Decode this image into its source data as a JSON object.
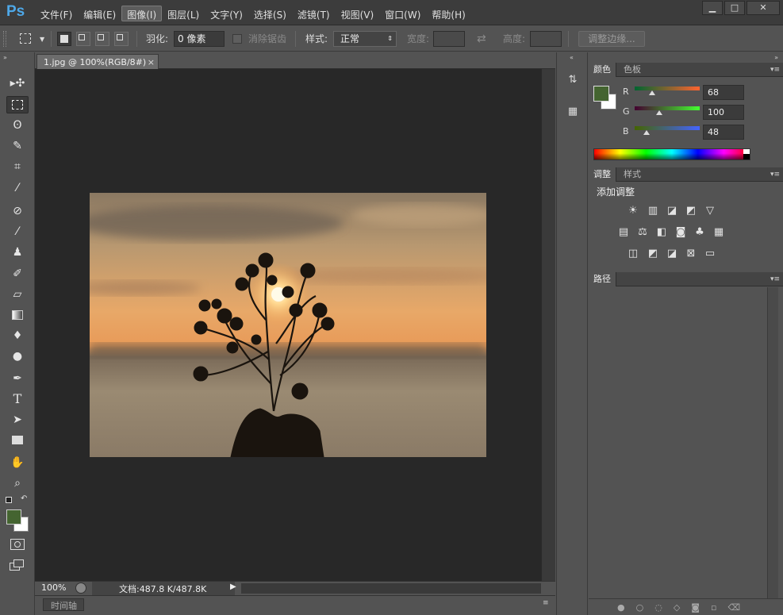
{
  "app": {
    "logo": "Ps"
  },
  "menu": [
    "文件(F)",
    "编辑(E)",
    "图像(I)",
    "图层(L)",
    "文字(Y)",
    "选择(S)",
    "滤镜(T)",
    "视图(V)",
    "窗口(W)",
    "帮助(H)"
  ],
  "menu_active_index": 2,
  "window_controls": {
    "minimize": "▁",
    "maximize": "□",
    "close": "✕"
  },
  "options": {
    "feather_label": "羽化:",
    "feather_value": "0 像素",
    "antialias_label": "消除锯齿",
    "style_label": "样式:",
    "style_value": "正常",
    "width_label": "宽度:",
    "height_label": "高度:",
    "refine_edge_label": "调整边缘..."
  },
  "document": {
    "tab_title": "1.jpg @ 100%(RGB/8#)",
    "close_glyph": "×",
    "zoom": "100%",
    "doc_info": "文档:487.8 K/487.8K",
    "timeline_label": "时间轴"
  },
  "color_panel": {
    "tabs": [
      "颜色",
      "色板"
    ],
    "r_label": "R",
    "g_label": "G",
    "b_label": "B",
    "r": 68,
    "g": 100,
    "b": 48,
    "foreground": "#446430",
    "background": "#ffffff"
  },
  "adjust_panel": {
    "tabs": [
      "调整",
      "样式"
    ],
    "title": "添加调整"
  },
  "paths_panel": {
    "tabs": [
      "路径"
    ]
  },
  "colors": {
    "accent_logo": "#4ea8e8",
    "foreground_swatch": "#446430"
  },
  "icons": {
    "tools": [
      "move-icon",
      "marquee-icon",
      "lasso-icon",
      "quick-select-icon",
      "crop-icon",
      "eyedropper-icon",
      "healing-brush-icon",
      "brush-icon",
      "clone-stamp-icon",
      "history-brush-icon",
      "eraser-icon",
      "gradient-icon",
      "blur-icon",
      "dodge-icon",
      "pen-icon",
      "type-icon",
      "path-select-icon",
      "shape-icon",
      "hand-icon",
      "zoom-icon"
    ],
    "adjustments": [
      "brightness-contrast-icon",
      "levels-icon",
      "curves-icon",
      "exposure-icon",
      "vibrance-icon",
      "hue-saturation-icon",
      "color-balance-icon",
      "black-white-icon",
      "photo-filter-icon",
      "channel-mixer-icon",
      "color-lookup-icon",
      "invert-icon",
      "posterize-icon",
      "threshold-icon",
      "selective-color-icon",
      "gradient-map-icon"
    ]
  }
}
